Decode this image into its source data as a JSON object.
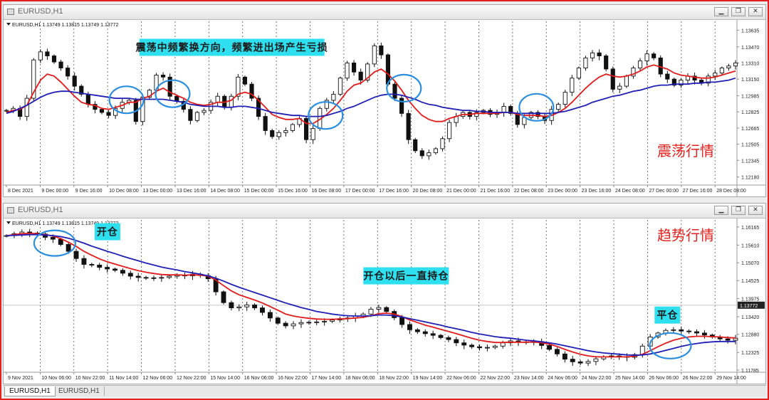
{
  "windows": [
    {
      "title": "EURUSD,H1",
      "info": "EURUSD,H1  1.13749 1.13815 1.13749 1.13772",
      "chart_data": {
        "type": "line",
        "title": "",
        "price_ticks": [
          "1.13635",
          "1.13470",
          "1.13310",
          "1.13150",
          "1.12985",
          "1.12825",
          "1.12665",
          "1.12505",
          "1.12345",
          "1.12180"
        ],
        "price_range": [
          1.121,
          1.1368
        ],
        "time_labels": [
          "8 Dec 2021",
          "9 Dec 00:00",
          "9 Dec 16:00",
          "10 Dec 08:00",
          "13 Dec 00:00",
          "13 Dec 16:00",
          "14 Dec 08:00",
          "15 Dec 00:00",
          "15 Dec 16:00",
          "16 Dec 08:00",
          "17 Dec 00:00",
          "17 Dec 16:00",
          "20 Dec 08:00",
          "21 Dec 00:00",
          "21 Dec 16:00",
          "22 Dec 08:00",
          "23 Dec 00:00",
          "23 Dec 16:00",
          "24 Dec 08:00",
          "27 Dec 00:00",
          "27 Dec 16:00",
          "28 Dec 08:00"
        ],
        "series": [
          {
            "name": "",
            "color": "#111111",
            "style": "candles",
            "values": [
              1.1284,
              1.1286,
              1.1278,
              1.1296,
              1.1334,
              1.1342,
              1.1338,
              1.1332,
              1.1326,
              1.1318,
              1.1308,
              1.13,
              1.129,
              1.1285,
              1.1282,
              1.1279,
              1.1286,
              1.1292,
              1.1294,
              1.1273,
              1.1297,
              1.1304,
              1.1319,
              1.1317,
              1.1298,
              1.1293,
              1.1285,
              1.1274,
              1.1282,
              1.1284,
              1.1292,
              1.1298,
              1.1287,
              1.1298,
              1.1317,
              1.131,
              1.1296,
              1.1278,
              1.1264,
              1.1258,
              1.1262,
              1.1264,
              1.127,
              1.1276,
              1.1255,
              1.1266,
              1.1286,
              1.1294,
              1.13,
              1.1316,
              1.1331,
              1.1322,
              1.1314,
              1.133,
              1.1348,
              1.1339,
              1.131,
              1.1296,
              1.1281,
              1.1255,
              1.1244,
              1.1239,
              1.1242,
              1.1246,
              1.1256,
              1.1272,
              1.1278,
              1.1282,
              1.1278,
              1.1282,
              1.1284,
              1.128,
              1.1282,
              1.1288,
              1.1281,
              1.127,
              1.1277,
              1.1282,
              1.1278,
              1.1274,
              1.1285,
              1.129,
              1.1302,
              1.1316,
              1.1326,
              1.1336,
              1.1341,
              1.1338,
              1.1325,
              1.1305,
              1.1308,
              1.1318,
              1.1326,
              1.1333,
              1.134,
              1.1336,
              1.132,
              1.1315,
              1.1309,
              1.1314,
              1.1318,
              1.1314,
              1.1311,
              1.1318,
              1.1321,
              1.1326,
              1.1328,
              1.1331
            ]
          },
          {
            "name": "",
            "color": "#e21b1b",
            "style": "line",
            "values": [
              1.1282,
              1.1284,
              1.1285,
              1.1289,
              1.1302,
              1.1314,
              1.132,
              1.1318,
              1.1312,
              1.1305,
              1.1298,
              1.1292,
              1.129,
              1.1289,
              1.1286,
              1.1285,
              1.1287,
              1.1289,
              1.1292,
              1.1292,
              1.1296,
              1.1298,
              1.1303,
              1.1306,
              1.1302,
              1.1299,
              1.1296,
              1.1292,
              1.129,
              1.1289,
              1.129,
              1.1292,
              1.1292,
              1.1294,
              1.13,
              1.1302,
              1.13,
              1.1294,
              1.1287,
              1.128,
              1.1277,
              1.1275,
              1.1275,
              1.1276,
              1.1271,
              1.1271,
              1.1275,
              1.128,
              1.1286,
              1.1294,
              1.1303,
              1.1309,
              1.1311,
              1.1316,
              1.1322,
              1.1325,
              1.132,
              1.1313,
              1.1304,
              1.1294,
              1.1286,
              1.1279,
              1.1275,
              1.1273,
              1.1273,
              1.1276,
              1.1278,
              1.128,
              1.128,
              1.1281,
              1.1281,
              1.1281,
              1.1281,
              1.1282,
              1.1282,
              1.128,
              1.1279,
              1.1279,
              1.1279,
              1.1278,
              1.1279,
              1.1282,
              1.1286,
              1.1292,
              1.1299,
              1.1306,
              1.1312,
              1.1317,
              1.132,
              1.1318,
              1.1317,
              1.1318,
              1.132,
              1.1323,
              1.1327,
              1.1329,
              1.1327,
              1.1325,
              1.1321,
              1.1319,
              1.1318,
              1.1317,
              1.1316,
              1.1316,
              1.1317,
              1.1319,
              1.1321,
              1.1323
            ]
          },
          {
            "name": "",
            "color": "#1f1fb6",
            "style": "line",
            "values": [
              1.1281,
              1.1283,
              1.1286,
              1.1289,
              1.1293,
              1.1297,
              1.13,
              1.1302,
              1.1303,
              1.1303,
              1.1302,
              1.1301,
              1.13,
              1.1299,
              1.1298,
              1.1297,
              1.1296,
              1.1296,
              1.1296,
              1.1295,
              1.1295,
              1.1295,
              1.1295,
              1.1295,
              1.1294,
              1.1293,
              1.1292,
              1.129,
              1.1289,
              1.1288,
              1.1288,
              1.1288,
              1.1287,
              1.1287,
              1.1288,
              1.1288,
              1.1287,
              1.1286,
              1.1284,
              1.1282,
              1.1281,
              1.128,
              1.1279,
              1.1279,
              1.1278,
              1.1278,
              1.1278,
              1.1279,
              1.1281,
              1.1283,
              1.1286,
              1.1288,
              1.1291,
              1.1294,
              1.1297,
              1.1299,
              1.13,
              1.13,
              1.1299,
              1.1297,
              1.1295,
              1.1292,
              1.129,
              1.1289,
              1.1287,
              1.1286,
              1.1285,
              1.1284,
              1.1284,
              1.1283,
              1.1283,
              1.1282,
              1.1282,
              1.1282,
              1.1282,
              1.1281,
              1.1281,
              1.1281,
              1.1281,
              1.1281,
              1.1281,
              1.1282,
              1.1283,
              1.1285,
              1.1287,
              1.1289,
              1.1292,
              1.1294,
              1.1296,
              1.1298,
              1.1299,
              1.1301,
              1.1303,
              1.1304,
              1.1306,
              1.1308,
              1.1309,
              1.1309,
              1.131,
              1.131,
              1.131,
              1.1311,
              1.1311,
              1.1312,
              1.1312,
              1.1313,
              1.1314,
              1.1316
            ]
          }
        ],
        "current_price": "",
        "annotations": [
          {
            "kind": "label",
            "text": "震荡中频繁换方向，频繁进出场产生亏损",
            "x": 0.31,
            "y": 1.13465
          },
          {
            "kind": "title",
            "text": "震荡行情",
            "x": 0.93,
            "y": 1.1239
          },
          {
            "kind": "ellipse",
            "x": 0.166,
            "y": 1.12945
          },
          {
            "kind": "ellipse",
            "x": 0.229,
            "y": 1.13005
          },
          {
            "kind": "ellipse",
            "x": 0.438,
            "y": 1.1279
          },
          {
            "kind": "ellipse",
            "x": 0.545,
            "y": 1.1306
          },
          {
            "kind": "ellipse",
            "x": 0.726,
            "y": 1.1287
          }
        ]
      }
    },
    {
      "title": "EURUSD,H1",
      "info": "EURUSD,H1  1.13749 1.13815 1.13749 1.13772",
      "chart_data": {
        "type": "line",
        "title": "",
        "price_ticks": [
          "1.16165",
          "1.15610",
          "1.15070",
          "1.14525",
          "1.13975",
          "1.13420",
          "1.12880",
          "1.12325",
          "1.11785"
        ],
        "price_range": [
          1.1172,
          1.1625
        ],
        "time_labels": [
          "9 Nov 2021",
          "10 Nov 06:00",
          "10 Nov 22:00",
          "11 Nov 14:00",
          "12 Nov 06:00",
          "12 Nov 22:00",
          "15 Nov 14:00",
          "16 Nov 06:00",
          "16 Nov 22:00",
          "17 Nov 14:00",
          "18 Nov 06:00",
          "18 Nov 22:00",
          "19 Nov 14:00",
          "22 Nov 06:00",
          "22 Nov 22:00",
          "23 Nov 14:00",
          "24 Nov 06:00",
          "24 Nov 22:00",
          "25 Nov 14:00",
          "26 Nov 06:00",
          "26 Nov 22:00",
          "29 Nov 14:00"
        ],
        "series": [
          {
            "name": "",
            "color": "#111111",
            "style": "candles",
            "values": [
              1.159,
              1.1596,
              1.1601,
              1.1598,
              1.1595,
              1.1585,
              1.1579,
              1.1563,
              1.1542,
              1.152,
              1.1502,
              1.15,
              1.1493,
              1.1488,
              1.1484,
              1.1475,
              1.1466,
              1.1462,
              1.1461,
              1.146,
              1.1462,
              1.1466,
              1.1469,
              1.1467,
              1.1472,
              1.1468,
              1.1458,
              1.1418,
              1.1385,
              1.1369,
              1.1372,
              1.1378,
              1.1369,
              1.1355,
              1.1338,
              1.1322,
              1.1314,
              1.132,
              1.1324,
              1.1325,
              1.1326,
              1.1328,
              1.1332,
              1.1336,
              1.1338,
              1.1344,
              1.135,
              1.1365,
              1.137,
              1.1358,
              1.1339,
              1.1318,
              1.1302,
              1.1296,
              1.129,
              1.1285,
              1.1278,
              1.1272,
              1.1262,
              1.1255,
              1.125,
              1.1247,
              1.1248,
              1.1252,
              1.1262,
              1.1268,
              1.1265,
              1.1263,
              1.1266,
              1.1254,
              1.1242,
              1.1228,
              1.1212,
              1.1204,
              1.12,
              1.1205,
              1.1213,
              1.122,
              1.1222,
              1.122,
              1.1218,
              1.1226,
              1.1252,
              1.128,
              1.1292,
              1.13,
              1.1302,
              1.1298,
              1.1296,
              1.1292,
              1.1286,
              1.128,
              1.1274,
              1.127,
              1.1276
            ]
          },
          {
            "name": "",
            "color": "#e21b1b",
            "style": "line",
            "values": [
              1.159,
              1.1593,
              1.1596,
              1.1597,
              1.1596,
              1.1593,
              1.1589,
              1.1581,
              1.157,
              1.1557,
              1.1542,
              1.153,
              1.1519,
              1.151,
              1.1503,
              1.1496,
              1.1489,
              1.1483,
              1.1478,
              1.1474,
              1.1471,
              1.147,
              1.147,
              1.1469,
              1.147,
              1.1469,
              1.1466,
              1.1454,
              1.1437,
              1.1421,
              1.1409,
              1.1401,
              1.1393,
              1.1384,
              1.1373,
              1.1362,
              1.135,
              1.1344,
              1.134,
              1.1337,
              1.1335,
              1.1334,
              1.1334,
              1.1335,
              1.1336,
              1.1338,
              1.134,
              1.1345,
              1.1351,
              1.1353,
              1.135,
              1.1342,
              1.1332,
              1.1324,
              1.1316,
              1.131,
              1.1303,
              1.1297,
              1.129,
              1.1283,
              1.1276,
              1.127,
              1.1266,
              1.1263,
              1.1263,
              1.1264,
              1.1264,
              1.1264,
              1.1265,
              1.1262,
              1.1258,
              1.1251,
              1.1242,
              1.1234,
              1.1227,
              1.1222,
              1.1219,
              1.1219,
              1.1219,
              1.1219,
              1.1219,
              1.1221,
              1.1227,
              1.1238,
              1.125,
              1.1261,
              1.127,
              1.1276,
              1.128,
              1.1282,
              1.1282,
              1.1281,
              1.128,
              1.1278,
              1.1277
            ]
          },
          {
            "name": "",
            "color": "#1f1fb6",
            "style": "line",
            "values": [
              1.159,
              1.1591,
              1.1592,
              1.1593,
              1.1593,
              1.1592,
              1.159,
              1.1587,
              1.1582,
              1.1575,
              1.1567,
              1.1558,
              1.155,
              1.1542,
              1.1535,
              1.1527,
              1.152,
              1.1513,
              1.1506,
              1.15,
              1.1494,
              1.1489,
              1.1485,
              1.148,
              1.1476,
              1.1472,
              1.1467,
              1.146,
              1.1451,
              1.1441,
              1.1432,
              1.1424,
              1.1416,
              1.1408,
              1.14,
              1.1392,
              1.1384,
              1.1377,
              1.137,
              1.1364,
              1.1358,
              1.1354,
              1.135,
              1.1347,
              1.1345,
              1.1344,
              1.1344,
              1.1345,
              1.1347,
              1.1347,
              1.1345,
              1.1341,
              1.1336,
              1.1331,
              1.1326,
              1.1321,
              1.1316,
              1.131,
              1.1305,
              1.13,
              1.1294,
              1.1289,
              1.1285,
              1.1281,
              1.1278,
              1.1276,
              1.1273,
              1.127,
              1.1268,
              1.1265,
              1.1262,
              1.1258,
              1.1253,
              1.1248,
              1.1243,
              1.1238,
              1.1234,
              1.1231,
              1.1229,
              1.1227,
              1.1225,
              1.1224,
              1.1225,
              1.1228,
              1.1233,
              1.1239,
              1.1245,
              1.1251,
              1.1256,
              1.126,
              1.1263,
              1.1265,
              1.1266,
              1.1266,
              1.1266
            ]
          }
        ],
        "current_price": "1.13772",
        "annotations": [
          {
            "kind": "label",
            "text": "开仓",
            "x": 0.14,
            "y": 1.1602
          },
          {
            "kind": "title",
            "text": "趋势行情",
            "x": 0.93,
            "y": 1.1576
          },
          {
            "kind": "label",
            "text": "开仓以后一直持仓",
            "x": 0.548,
            "y": 1.1467
          },
          {
            "kind": "label",
            "text": "平仓",
            "x": 0.905,
            "y": 1.1347
          },
          {
            "kind": "ellipse",
            "x": 0.068,
            "y": 1.1567
          },
          {
            "kind": "ellipse",
            "x": 0.909,
            "y": 1.1253
          }
        ]
      }
    }
  ],
  "window_buttons": [
    "▁",
    "❐",
    "✕"
  ],
  "tabs": [
    {
      "label": "EURUSD,H1",
      "active": true
    },
    {
      "label": "EURUSD,H1",
      "active": false
    }
  ]
}
